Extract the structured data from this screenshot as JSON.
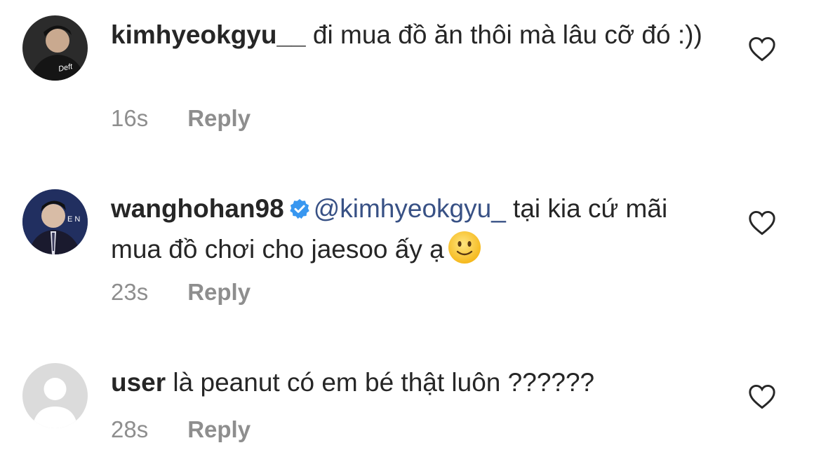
{
  "comments": [
    {
      "username": "kimhyeokgyu__",
      "text": " đi mua đồ ăn thôi mà lâu cỡ đó :))",
      "avatar_label": "Deft",
      "time": "16s",
      "reply_label": "Reply"
    },
    {
      "username": "wanghohan98",
      "mention": "@kimhyeokgyu_",
      "text": " tại kia cứ mãi mua đồ chơi cho jaesoo ấy ạ",
      "avatar_label": "E N",
      "time": "23s",
      "reply_label": "Reply"
    },
    {
      "username": "user",
      "text": " là peanut có em bé thật luôn ??????",
      "time": "28s",
      "reply_label": "Reply"
    }
  ],
  "colors": {
    "text": "#262626",
    "secondary": "#8e8e8e",
    "mention": "#385185",
    "verified": "#3897f0"
  }
}
